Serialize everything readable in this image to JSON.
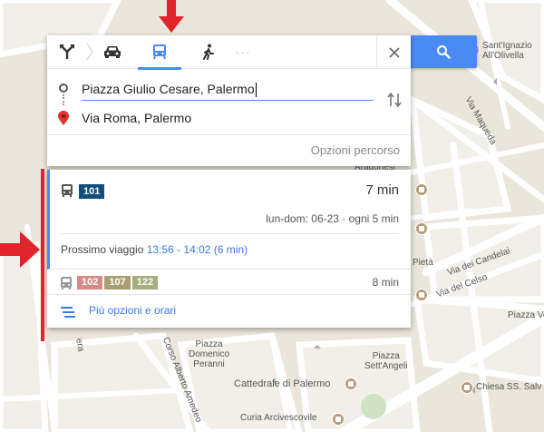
{
  "modes": {
    "close_label": "×",
    "more_label": "···"
  },
  "fields": {
    "origin_value": "Piazza Giulio Cesare, Palermo",
    "destination_value": "Via Roma, Palermo"
  },
  "route_options_label": "Opzioni percorso",
  "routes": {
    "primary": {
      "line": "101",
      "line_color": "#0e4e78",
      "duration": "7 min",
      "schedule": "lun-dom: 06-23 · ogni 5 min",
      "next_trip_label": "Prossimo viaggio",
      "next_trip_times": "13:56 - 14:02 (6 min)"
    },
    "alternative": {
      "lines": [
        {
          "label": "102",
          "color": "#d98989"
        },
        {
          "label": "107",
          "color": "#a59f73"
        },
        {
          "label": "122",
          "color": "#a6ad7e"
        }
      ],
      "duration": "8 min"
    },
    "more_options_label": "Più opzioni e orari"
  },
  "map_labels": {
    "sant_ignazio": "Sant'Ignazio\nAll'Olivella",
    "via_maqueda": "Via Maqueda",
    "aragonesi": "Aragonesi",
    "pieta": "Pietà",
    "via_dei_candelai": "Via dei Candelai",
    "via_del_celso": "Via del Celso",
    "piazza_ver": "Piazza Ver",
    "piazza_domenico_peranni": "Piazza\nDomenico\nPeranni",
    "piazza_settangeli": "Piazza\nSett'Angeli",
    "cattedrale": "Cattedrale di Palermo",
    "chiesa_ss_salv": "Chiesa SS. Salv",
    "curia": "Curia Arcivescovile",
    "corso_alberto_amedeo": "Corso Alberto Amedeo",
    "era": "era"
  },
  "colors": {
    "accent_blue": "#4a8af4",
    "annotation_red": "#e0242b"
  }
}
